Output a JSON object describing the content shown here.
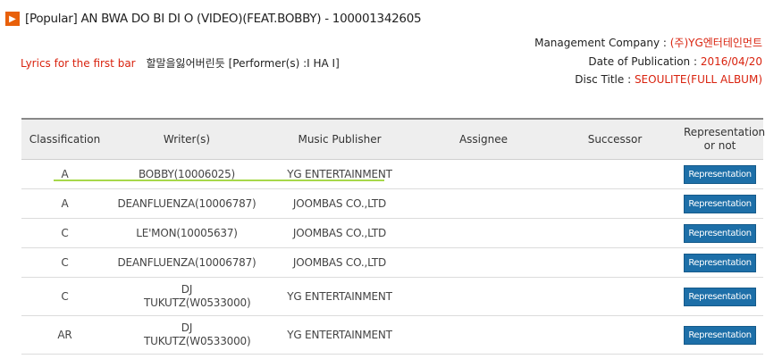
{
  "header": {
    "icon": "play-arrow-icon",
    "accent_color": "#e8600a",
    "title": "[Popular] AN BWA DO BI DI O (VIDEO)(FEAT.BOBBY) - 100001342605"
  },
  "meta": {
    "company_label": "Management Company : ",
    "company_value": "(주)YG엔터테인먼트",
    "date_label": "Date of Publication : ",
    "date_value": "2016/04/20",
    "disc_label": "Disc Title : ",
    "disc_value": "SEOULITE(FULL ALBUM)",
    "value_color": "#d9230f"
  },
  "lyrics": {
    "label": "Lyrics for the first bar",
    "text": "할말을잃어버린듯 [Performer(s) :I HA I]"
  },
  "table": {
    "columns": [
      "Classification",
      "Writer(s)",
      "Music Publisher",
      "Assignee",
      "Successor",
      "Representation or not"
    ],
    "rows": [
      {
        "classification": "A",
        "writer": "BOBBY(10006025)",
        "publisher": "YG ENTERTAINMENT",
        "assignee": "",
        "successor": "",
        "representation": "Representation"
      },
      {
        "classification": "A",
        "writer": "DEANFLUENZA(10006787)",
        "publisher": "JOOMBAS CO.,LTD",
        "assignee": "",
        "successor": "",
        "representation": "Representation"
      },
      {
        "classification": "C",
        "writer": "LE'MON(10005637)",
        "publisher": "JOOMBAS CO.,LTD",
        "assignee": "",
        "successor": "",
        "representation": "Representation"
      },
      {
        "classification": "C",
        "writer": "DEANFLUENZA(10006787)",
        "publisher": "JOOMBAS CO.,LTD",
        "assignee": "",
        "successor": "",
        "representation": "Representation"
      },
      {
        "classification": "C",
        "writer": "DJ TUKUTZ(W0533000)",
        "publisher": "YG ENTERTAINMENT",
        "assignee": "",
        "successor": "",
        "representation": "Representation"
      },
      {
        "classification": "AR",
        "writer": "DJ TUKUTZ(W0533000)",
        "publisher": "YG ENTERTAINMENT",
        "assignee": "",
        "successor": "",
        "representation": "Representation"
      }
    ],
    "button_color": "#1d6fa8",
    "highlight_color": "#a7d84a"
  }
}
